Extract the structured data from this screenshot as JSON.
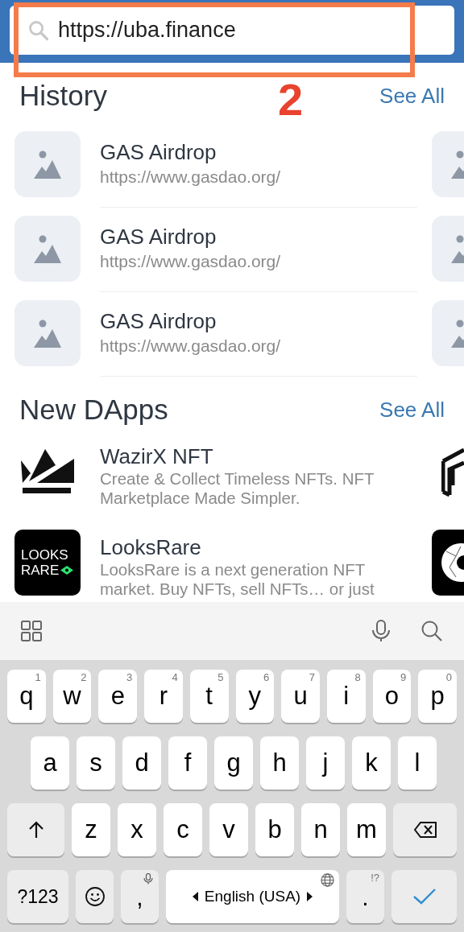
{
  "search": {
    "value": "https://uba.finance"
  },
  "annotation": {
    "label": "2"
  },
  "sections": [
    {
      "kind": "history",
      "title": "History",
      "action": "See All",
      "items": [
        {
          "title": "GAS Airdrop",
          "subtitle": "https://www.gasdao.org/"
        },
        {
          "title": "GAS Airdrop",
          "subtitle": "https://www.gasdao.org/"
        },
        {
          "title": "GAS Airdrop",
          "subtitle": "https://www.gasdao.org/"
        }
      ]
    },
    {
      "kind": "dapps",
      "title": "New DApps",
      "action": "See All",
      "items": [
        {
          "title": "WazirX NFT",
          "subtitle": "Create & Collect Timeless NFTs. NFT Marketplace Made Simpler.",
          "kind": "crown"
        },
        {
          "title": "LooksRare",
          "subtitle": "LooksRare is a next generation NFT market. Buy NFTs, sell NFTs… or just",
          "kind": "looksrare",
          "logo_lines": [
            "LOOKS",
            "RARE"
          ]
        }
      ]
    }
  ],
  "keyboard": {
    "rows": [
      {
        "keys": [
          {
            "kind": "letter",
            "label": "q",
            "hint": "1"
          },
          {
            "kind": "letter",
            "label": "w",
            "hint": "2"
          },
          {
            "kind": "letter",
            "label": "e",
            "hint": "3"
          },
          {
            "kind": "letter",
            "label": "r",
            "hint": "4"
          },
          {
            "kind": "letter",
            "label": "t",
            "hint": "5"
          },
          {
            "kind": "letter",
            "label": "y",
            "hint": "6"
          },
          {
            "kind": "letter",
            "label": "u",
            "hint": "7"
          },
          {
            "kind": "letter",
            "label": "i",
            "hint": "8"
          },
          {
            "kind": "letter",
            "label": "o",
            "hint": "9"
          },
          {
            "kind": "letter",
            "label": "p",
            "hint": "0"
          }
        ]
      },
      {
        "keys": [
          {
            "kind": "letter",
            "label": "a"
          },
          {
            "kind": "letter",
            "label": "s"
          },
          {
            "kind": "letter",
            "label": "d"
          },
          {
            "kind": "letter",
            "label": "f"
          },
          {
            "kind": "letter",
            "label": "g"
          },
          {
            "kind": "letter",
            "label": "h"
          },
          {
            "kind": "letter",
            "label": "j"
          },
          {
            "kind": "letter",
            "label": "k"
          },
          {
            "kind": "letter",
            "label": "l"
          }
        ]
      },
      {
        "keys": [
          {
            "kind": "shift"
          },
          {
            "kind": "letter",
            "label": "z"
          },
          {
            "kind": "letter",
            "label": "x"
          },
          {
            "kind": "letter",
            "label": "c"
          },
          {
            "kind": "letter",
            "label": "v"
          },
          {
            "kind": "letter",
            "label": "b"
          },
          {
            "kind": "letter",
            "label": "n"
          },
          {
            "kind": "letter",
            "label": "m"
          },
          {
            "kind": "backspace"
          }
        ]
      },
      {
        "keys": [
          {
            "kind": "symbols",
            "label": "?123"
          },
          {
            "kind": "emoji"
          },
          {
            "kind": "comma",
            "label": ","
          },
          {
            "kind": "space",
            "label": "English (USA)"
          },
          {
            "kind": "period",
            "label": ".",
            "hint": "!?"
          },
          {
            "kind": "enter"
          }
        ]
      }
    ]
  }
}
